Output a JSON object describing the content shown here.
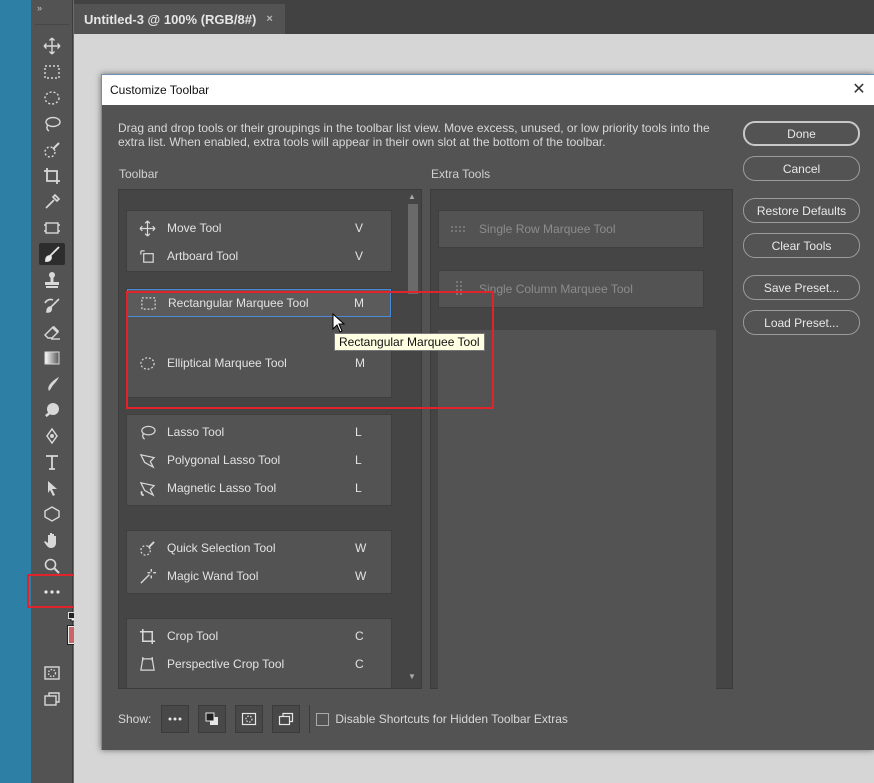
{
  "document": {
    "tab_title": "Untitled-3 @ 100% (RGB/8#)",
    "tab_close_glyph": "×"
  },
  "toolstrip": {
    "collapse_glyph": "»",
    "tools": [
      {
        "name": "move-icon"
      },
      {
        "name": "rect-marquee-icon"
      },
      {
        "name": "ellipse-marquee-icon"
      },
      {
        "name": "lasso-icon"
      },
      {
        "name": "quick-selection-icon"
      },
      {
        "name": "crop-icon"
      },
      {
        "name": "eyedropper-icon"
      },
      {
        "name": "frame-icon"
      },
      {
        "name": "brush-icon"
      },
      {
        "name": "stamp-icon"
      },
      {
        "name": "history-brush-icon"
      },
      {
        "name": "eraser-icon"
      },
      {
        "name": "gradient-icon"
      },
      {
        "name": "smudge-icon"
      },
      {
        "name": "dodge-icon"
      },
      {
        "name": "pen-icon"
      },
      {
        "name": "type-icon"
      },
      {
        "name": "path-selection-icon"
      },
      {
        "name": "shape-icon"
      },
      {
        "name": "hand-icon"
      },
      {
        "name": "zoom-icon"
      },
      {
        "name": "more-tools-icon"
      }
    ],
    "foreground_color": "#c8646a",
    "background_color": "#ffffff"
  },
  "dialog": {
    "title": "Customize Toolbar",
    "close_glyph": "✕",
    "description": "Drag and drop tools or their groupings in the toolbar list view. Move excess, unused, or low priority tools into the extra list. When enabled, extra tools will appear in their own slot at the bottom of the toolbar.",
    "toolbar_label": "Toolbar",
    "extra_label": "Extra Tools",
    "groups": [
      {
        "items": [
          {
            "name": "Move Tool",
            "key": "V"
          },
          {
            "name": "Artboard Tool",
            "key": "V"
          }
        ]
      },
      {
        "items": [
          {
            "name": "Rectangular Marquee Tool",
            "key": "M"
          },
          {
            "name": "Elliptical Marquee Tool",
            "key": "M"
          }
        ]
      },
      {
        "items": [
          {
            "name": "Lasso Tool",
            "key": "L"
          },
          {
            "name": "Polygonal Lasso Tool",
            "key": "L"
          },
          {
            "name": "Magnetic Lasso Tool",
            "key": "L"
          }
        ]
      },
      {
        "items": [
          {
            "name": "Quick Selection Tool",
            "key": "W"
          },
          {
            "name": "Magic Wand Tool",
            "key": "W"
          }
        ]
      },
      {
        "items": [
          {
            "name": "Crop Tool",
            "key": "C"
          },
          {
            "name": "Perspective Crop Tool",
            "key": "C"
          }
        ]
      }
    ],
    "extra_tools": [
      {
        "name": "Single Row Marquee Tool"
      },
      {
        "name": "Single Column Marquee Tool"
      }
    ],
    "tooltip": "Rectangular Marquee Tool",
    "buttons": {
      "done": "Done",
      "cancel": "Cancel",
      "restore": "Restore Defaults",
      "clear": "Clear Tools",
      "save": "Save Preset...",
      "load": "Load Preset..."
    },
    "show_label": "Show:",
    "disable_shortcuts_label": "Disable Shortcuts for Hidden Toolbar Extras",
    "disable_shortcuts_checked": false,
    "highlight_color": "#e1232b",
    "selection_color": "#4b8ad6"
  }
}
